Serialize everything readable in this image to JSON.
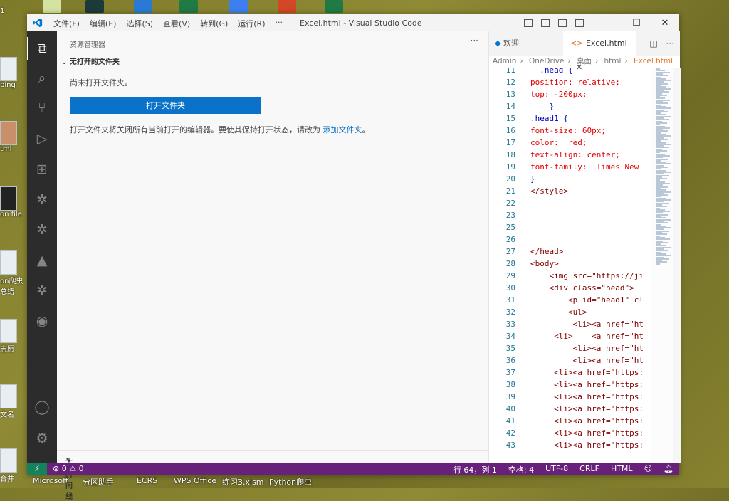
{
  "desktop": {
    "left_labels": [
      "1",
      "bing",
      "tml",
      "on file",
      "on爬虫",
      "总结",
      "志愿",
      "文名",
      "合并"
    ],
    "taskbar_labels": [
      "Microsoft",
      "分区助手",
      "ECRS",
      "WPS Office",
      "练习3.xlsm",
      "Python爬虫"
    ]
  },
  "titlebar": {
    "menu": [
      "文件(F)",
      "编辑(E)",
      "选择(S)",
      "查看(V)",
      "转到(G)",
      "运行(R)",
      "···"
    ],
    "title": "Excel.html - Visual Studio Code",
    "min": "—",
    "max": "☐",
    "close": "✕"
  },
  "sidebar": {
    "title": "资源管理器",
    "more": "···",
    "section": "无打开的文件夹",
    "message": "尚未打开文件夹。",
    "open_button": "打开文件夹",
    "note": "打开文件夹将关闭所有当前打开的编辑器。要使其保持打开状态，请改为 ",
    "note_link": "添加文件夹",
    "note_end": "。",
    "outline": "大纲",
    "timeline": "时间线"
  },
  "editor": {
    "tabs": [
      {
        "label": "欢迎"
      },
      {
        "label": "Excel.html",
        "close": "✕"
      }
    ],
    "breadcrumb": [
      "Admin",
      "OneDrive",
      "桌面",
      "html",
      "Excel.html"
    ],
    "lines": [
      {
        "n": "11",
        "text": "  .head {"
      },
      {
        "n": "12",
        "text": "position: relative;"
      },
      {
        "n": "13",
        "text": "top: -200px;"
      },
      {
        "n": "14",
        "text": "    }"
      },
      {
        "n": "15",
        "text": ".head1 {"
      },
      {
        "n": "16",
        "text": "font-size: 60px;"
      },
      {
        "n": "17",
        "text": "color:  red;"
      },
      {
        "n": "18",
        "text": "text-align: center;"
      },
      {
        "n": "19",
        "text": "font-family: 'Times New"
      },
      {
        "n": "20",
        "text": "}"
      },
      {
        "n": "21",
        "text": "</style>"
      },
      {
        "n": "22",
        "text": ""
      },
      {
        "n": "23",
        "text": ""
      },
      {
        "n": "25",
        "text": ""
      },
      {
        "n": "26",
        "text": ""
      },
      {
        "n": "27",
        "text": "</head>"
      },
      {
        "n": "28",
        "text": "<body>"
      },
      {
        "n": "29",
        "text": "    <img src=\"https://ji"
      },
      {
        "n": "30",
        "text": "    <div class=\"head\">"
      },
      {
        "n": "31",
        "text": "        <p id=\"head1\" cl"
      },
      {
        "n": "32",
        "text": "        <ul>"
      },
      {
        "n": "33",
        "text": "         <li><a href=\"ht"
      },
      {
        "n": "34",
        "text": "     <li>    <a href=\"ht"
      },
      {
        "n": "35",
        "text": "         <li><a href=\"ht"
      },
      {
        "n": "36",
        "text": "         <li><a href=\"ht"
      },
      {
        "n": "37",
        "text": "     <li><a href=\"https:"
      },
      {
        "n": "38",
        "text": "     <li><a href=\"https:"
      },
      {
        "n": "39",
        "text": "     <li><a href=\"https:"
      },
      {
        "n": "40",
        "text": "     <li><a href=\"https:"
      },
      {
        "n": "41",
        "text": "     <li><a href=\"https:"
      },
      {
        "n": "42",
        "text": "     <li><a href=\"https:"
      },
      {
        "n": "43",
        "text": "     <li><a href=\"https:"
      }
    ]
  },
  "statusbar": {
    "remote": "⚡",
    "problems": "⊗ 0 ⚠ 0",
    "position": "行 64，列 1",
    "indent": "空格: 4",
    "encoding": "UTF-8",
    "eol": "CRLF",
    "language": "HTML"
  },
  "colors": {
    "status": "#68217a",
    "button": "#0a72c8",
    "remote": "#16825d"
  }
}
